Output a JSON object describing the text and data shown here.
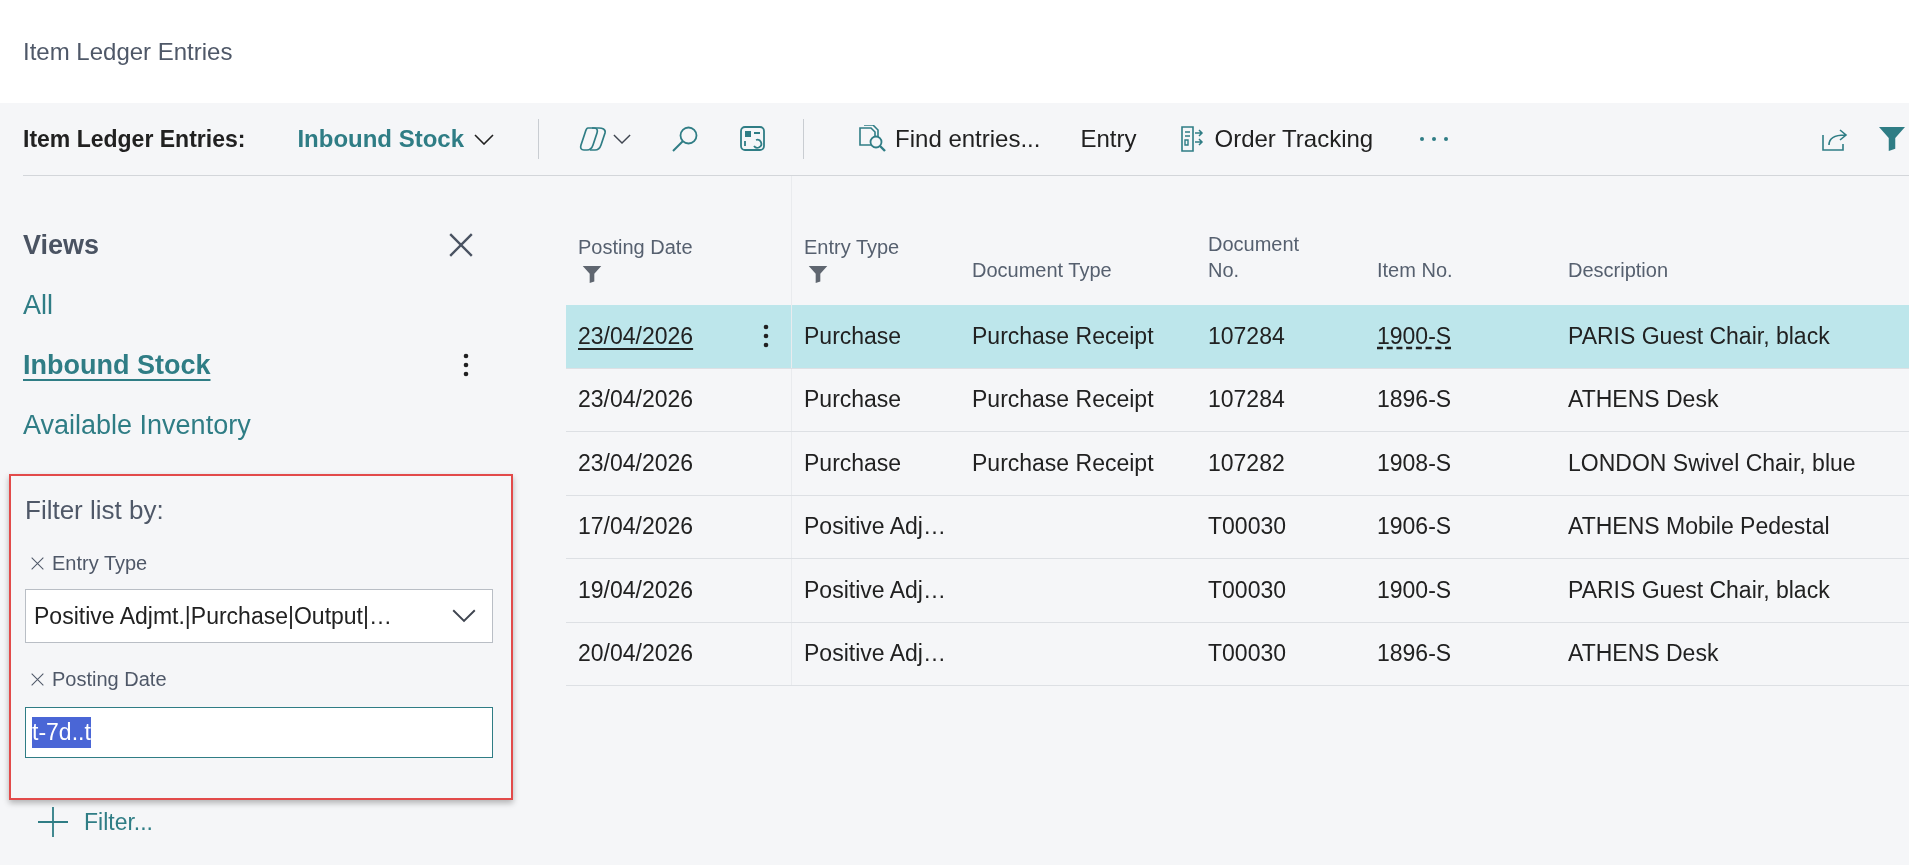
{
  "page": {
    "title": "Item Ledger Entries"
  },
  "action_bar": {
    "page_label": "Item Ledger Entries:",
    "view_selector": "Inbound Stock",
    "actions": [
      {
        "kind": "find",
        "label": "Find entries..."
      },
      {
        "kind": "plain",
        "label": "Entry"
      },
      {
        "kind": "tracking",
        "label": "Order Tracking"
      }
    ]
  },
  "views": {
    "title": "Views",
    "items": [
      {
        "label": "All",
        "selected": false
      },
      {
        "label": "Inbound Stock",
        "selected": true
      },
      {
        "label": "Available Inventory",
        "selected": false
      }
    ]
  },
  "filters": {
    "highlighted": true,
    "title": "Filter list by:",
    "fields": [
      {
        "label": "Entry Type",
        "kind": "dropdown",
        "value": "Positive Adjmt.|Purchase|Output|…",
        "focused": false
      },
      {
        "label": "Posting Date",
        "kind": "text",
        "value": "t-7d..t",
        "focused": true
      }
    ],
    "add_filter": "Filter..."
  },
  "table": {
    "columns": [
      {
        "label": "Posting Date",
        "filtered": true
      },
      {
        "label": "Entry Type",
        "filtered": true
      },
      {
        "label": "Document Type",
        "filtered": false
      },
      {
        "label": "Document No.",
        "filtered": false
      },
      {
        "label": "Item No.",
        "filtered": false
      },
      {
        "label": "Description",
        "filtered": false
      }
    ],
    "rows": [
      {
        "selected": true,
        "posting_date": "23/04/2026",
        "entry_type": "Purchase",
        "document_type": "Purchase Receipt",
        "document_no": "107284",
        "item_no": "1900-S",
        "description": "PARIS Guest Chair, black"
      },
      {
        "selected": false,
        "posting_date": "23/04/2026",
        "entry_type": "Purchase",
        "document_type": "Purchase Receipt",
        "document_no": "107284",
        "item_no": "1896-S",
        "description": "ATHENS Desk"
      },
      {
        "selected": false,
        "posting_date": "23/04/2026",
        "entry_type": "Purchase",
        "document_type": "Purchase Receipt",
        "document_no": "107282",
        "item_no": "1908-S",
        "description": "LONDON Swivel Chair, blue"
      },
      {
        "selected": false,
        "posting_date": "17/04/2026",
        "entry_type": "Positive Adj…",
        "document_no": "T00030",
        "item_no": "1906-S",
        "description": "ATHENS Mobile Pedestal"
      },
      {
        "selected": false,
        "posting_date": "19/04/2026",
        "entry_type": "Positive Adj…",
        "document_no": "T00030",
        "item_no": "1900-S",
        "description": "PARIS Guest Chair, black"
      },
      {
        "selected": false,
        "posting_date": "20/04/2026",
        "entry_type": "Positive Adj…",
        "document_no": "T00030",
        "item_no": "1896-S",
        "description": "ATHENS Desk"
      }
    ]
  }
}
